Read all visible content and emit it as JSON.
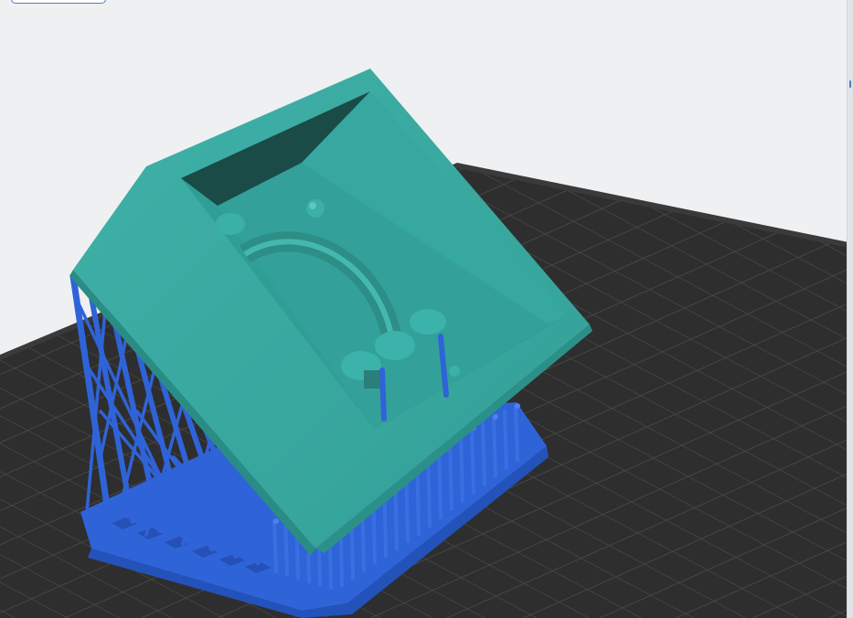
{
  "viewport": {
    "background": "#eef0f2",
    "bed_color": "#2f2f2f",
    "grid_color": "#4a4a4a",
    "model_color": "#3aa89f",
    "support_color": "#2f63d8"
  },
  "toolbar": {
    "top_button_label": ""
  }
}
